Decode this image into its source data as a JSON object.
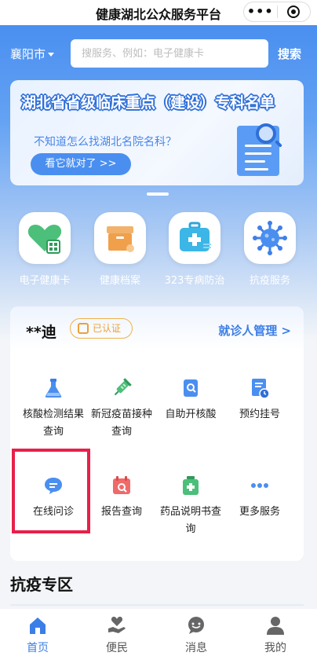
{
  "topbar": {
    "title": "健康湖北公众服务平台",
    "more": "•••"
  },
  "header": {
    "city": "襄阳市",
    "search_placeholder": "搜服务、例如：电子健康卡",
    "search_button": "搜索"
  },
  "banner": {
    "title": "湖北省省级临床重点（建设）专科名单",
    "subtitle": "不知道怎么找湖北名院名科？",
    "button": "看它就对了 >>"
  },
  "quick_actions": [
    {
      "label": "电子健康卡",
      "icon": "health-card-icon"
    },
    {
      "label": "健康档案",
      "icon": "archive-box-icon"
    },
    {
      "label": "323专病防治",
      "icon": "medical-kit-icon"
    },
    {
      "label": "抗疫服务",
      "icon": "virus-icon"
    }
  ],
  "user": {
    "name": "**迪",
    "badge": "已认证",
    "manage": "就诊人管理 >"
  },
  "services": [
    {
      "label": "核酸检测结果查询",
      "icon": "test-flask-icon"
    },
    {
      "label": "新冠疫苗接种查询",
      "icon": "vaccine-icon"
    },
    {
      "label": "自助开核酸",
      "icon": "self-service-icon"
    },
    {
      "label": "预约挂号",
      "icon": "appointment-icon"
    },
    {
      "label": "在线问诊",
      "icon": "chat-bubble-icon"
    },
    {
      "label": "报告查询",
      "icon": "calendar-report-icon"
    },
    {
      "label": "药品说明书查询",
      "icon": "medicine-icon"
    },
    {
      "label": "更多服务",
      "icon": "more-dots-icon"
    }
  ],
  "section": {
    "title": "抗疫专区"
  },
  "tabs": [
    {
      "label": "首页",
      "icon": "home-icon",
      "active": true
    },
    {
      "label": "便民",
      "icon": "heart-hand-icon",
      "active": false
    },
    {
      "label": "消息",
      "icon": "message-icon",
      "active": false
    },
    {
      "label": "我的",
      "icon": "user-icon",
      "active": false
    }
  ],
  "colors": {
    "primary": "#3b7ee6",
    "accent": "#4a8ff0",
    "highlight": "#e8204a",
    "verified": "#eca138"
  }
}
